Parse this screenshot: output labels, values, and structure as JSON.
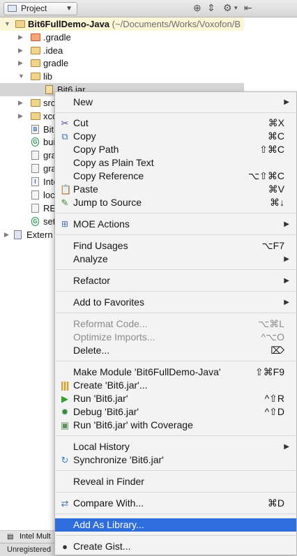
{
  "header": {
    "view_selector": "Project",
    "icons": [
      "sync-scroll-icon",
      "collapse-all-icon",
      "settings-gear-icon",
      "hide-panel-icon"
    ]
  },
  "tree": {
    "root": {
      "name": "Bit6FullDemo-Java",
      "path": "(~/Documents/Works/Voxofon/B"
    },
    "items": [
      {
        "label": ".gradle",
        "kind": "folder-excluded"
      },
      {
        "label": ".idea",
        "kind": "folder"
      },
      {
        "label": "gradle",
        "kind": "folder"
      },
      {
        "label": "lib",
        "kind": "folder",
        "expanded": true
      },
      {
        "label": "Bit6.jar",
        "kind": "jar",
        "selected": true
      },
      {
        "label": "src",
        "kind": "folder"
      },
      {
        "label": "xco",
        "kind": "folder"
      },
      {
        "label": "Bit6",
        "kind": "module-file"
      },
      {
        "label": "bui",
        "kind": "gradle-file"
      },
      {
        "label": "gra",
        "kind": "file"
      },
      {
        "label": "gra",
        "kind": "file"
      },
      {
        "label": "Inte",
        "kind": "module-file"
      },
      {
        "label": "loc",
        "kind": "file"
      },
      {
        "label": "REA",
        "kind": "file"
      },
      {
        "label": "set",
        "kind": "gradle-file"
      }
    ],
    "external": "Extern"
  },
  "bottom": {
    "tool_tab": "Intel Mult",
    "status_text": "Unregistered"
  },
  "menu": {
    "new": "New",
    "cut": "Cut",
    "cut_sc": "⌘X",
    "copy": "Copy",
    "copy_sc": "⌘C",
    "copy_path": "Copy Path",
    "copy_path_sc": "⇧⌘C",
    "copy_plain": "Copy as Plain Text",
    "copy_ref": "Copy Reference",
    "copy_ref_sc": "⌥⇧⌘C",
    "paste": "Paste",
    "paste_sc": "⌘V",
    "jump": "Jump to Source",
    "jump_sc": "⌘↓",
    "moe": "MOE Actions",
    "find_usages": "Find Usages",
    "find_usages_sc": "⌥F7",
    "analyze": "Analyze",
    "refactor": "Refactor",
    "favorites": "Add to Favorites",
    "reformat": "Reformat Code...",
    "reformat_sc": "⌥⌘L",
    "optimize": "Optimize Imports...",
    "optimize_sc": "^⌥O",
    "delete": "Delete...",
    "delete_sc": "⌦",
    "make_module": "Make Module 'Bit6FullDemo-Java'",
    "make_module_sc": "⇧⌘F9",
    "create": "Create 'Bit6.jar'...",
    "run": "Run 'Bit6.jar'",
    "run_sc": "^⇧R",
    "debug": "Debug 'Bit6.jar'",
    "debug_sc": "^⇧D",
    "coverage": "Run 'Bit6.jar' with Coverage",
    "local_history": "Local History",
    "synchronize": "Synchronize 'Bit6.jar'",
    "reveal": "Reveal in Finder",
    "compare": "Compare With...",
    "compare_sc": "⌘D",
    "add_library": "Add As Library...",
    "create_gist": "Create Gist...",
    "highlight_color": "#2e6ddc"
  }
}
